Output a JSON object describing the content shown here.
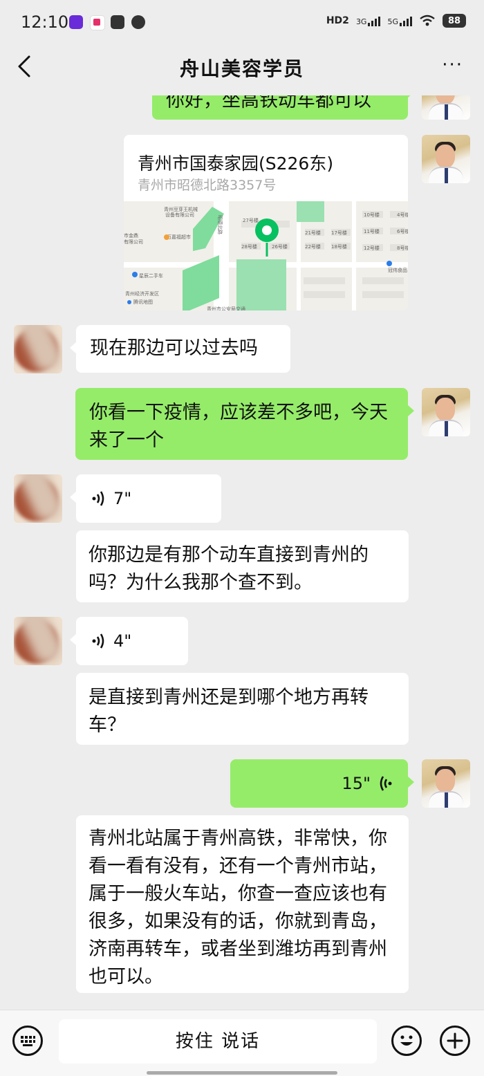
{
  "status_bar": {
    "time": "12:10",
    "hd": "HD2",
    "net1": "3G",
    "net2": "5G",
    "battery": "88"
  },
  "header": {
    "title": "舟山美容学员",
    "back_icon": "chevron-left-icon",
    "more_label": "···"
  },
  "messages": [
    {
      "id": "m0",
      "side": "me",
      "type": "text",
      "text": "你好，坐高铁动车都可以"
    },
    {
      "id": "m1",
      "side": "me",
      "type": "location",
      "name": "青州市国泰家园(S226东)",
      "address": "青州市昭德北路3357号",
      "map_labels": [
        "青州豆芽王机械设备有限公司",
        "万嘉福超市",
        "市金鼎有限公司",
        "星辰二手车",
        "青州经济开发区",
        "腾讯地图",
        "27号楼",
        "28号楼",
        "26号楼",
        "22号楼",
        "21号楼",
        "17号楼",
        "18号楼",
        "10号楼",
        "11号楼",
        "12号楼",
        "4号楼",
        "6号楼",
        "8号楼",
        "冠伟食品",
        "昭德北路",
        "青州市公安局交通"
      ]
    },
    {
      "id": "m2",
      "side": "other",
      "type": "text",
      "text": "现在那边可以过去吗"
    },
    {
      "id": "m3",
      "side": "me",
      "type": "text",
      "text": "你看一下疫情，应该差不多吧，今天来了一个"
    },
    {
      "id": "m4",
      "side": "other",
      "type": "voice",
      "duration": "7\""
    },
    {
      "id": "m5",
      "side": "other",
      "type": "text",
      "text": "你那边是有那个动车直接到青州的吗？为什么我那个查不到。"
    },
    {
      "id": "m6",
      "side": "other",
      "type": "voice",
      "duration": "4\""
    },
    {
      "id": "m7",
      "side": "other",
      "type": "text",
      "text": "是直接到青州还是到哪个地方再转车？"
    },
    {
      "id": "m8",
      "side": "me",
      "type": "voice",
      "duration": "15\""
    },
    {
      "id": "m9",
      "side": "other",
      "type": "text",
      "text": "青州北站属于青州高铁，非常快，你看一看有没有，还有一个青州市站，属于一般火车站，你查一查应该也有很多，如果没有的话，你就到青岛，济南再转车，或者坐到潍坊再到青州也可以。"
    }
  ],
  "input_bar": {
    "hold_to_talk": "按住 说话",
    "keyboard_icon": "keyboard-icon",
    "emoji_icon": "emoji-icon",
    "plus_icon": "plus-icon"
  },
  "colors": {
    "my_bubble": "#95ec69",
    "other_bubble": "#ffffff",
    "background": "#ededed",
    "map_pin": "#07c160"
  }
}
